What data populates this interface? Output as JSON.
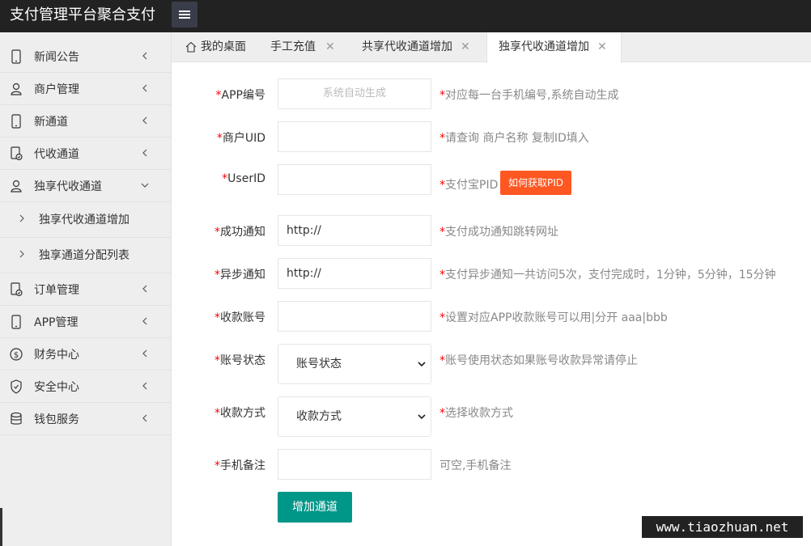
{
  "app": {
    "title": "支付管理平台聚合支付"
  },
  "sidebar": {
    "items": [
      {
        "label": "新闻公告",
        "icon": "phone-icon"
      },
      {
        "label": "商户管理",
        "icon": "user-icon"
      },
      {
        "label": "新通道",
        "icon": "phone-icon"
      },
      {
        "label": "代收通道",
        "icon": "document-check-icon"
      },
      {
        "label": "独享代收通道",
        "icon": "user-icon",
        "expanded": true,
        "children": [
          {
            "label": "独享代收通道增加"
          },
          {
            "label": "独享通道分配列表"
          }
        ]
      },
      {
        "label": "订单管理",
        "icon": "document-check-icon"
      },
      {
        "label": "APP管理",
        "icon": "phone-icon"
      },
      {
        "label": "财务中心",
        "icon": "dollar-circle-icon"
      },
      {
        "label": "安全中心",
        "icon": "shield-icon"
      },
      {
        "label": "钱包服务",
        "icon": "database-icon"
      }
    ]
  },
  "tabs": [
    {
      "label": "我的桌面",
      "icon": "home-icon",
      "closable": false
    },
    {
      "label": "手工充值",
      "closable": true
    },
    {
      "label": "共享代收通道增加",
      "closable": true
    },
    {
      "label": "独享代收通道增加",
      "closable": true,
      "active": true
    }
  ],
  "form": {
    "required_mark": "*",
    "fields": [
      {
        "label": "APP编号",
        "value": "",
        "placeholder": "系统自动生成",
        "hint": "对应每一台手机编号,系统自动生成",
        "required": true
      },
      {
        "label": "商户UID",
        "value": "",
        "hint": "请查询 商户名称 复制ID填入",
        "required": true
      },
      {
        "label": "UserID",
        "value": "",
        "hint": "支付宝PID",
        "required": true,
        "button": "如何获取PID"
      },
      {
        "label": "成功通知",
        "value": "http://",
        "hint": "支付成功通知跳转网址",
        "required": true
      },
      {
        "label": "异步通知",
        "value": "http://",
        "hint": "支付异步通知一共访问5次，支付完成时，1分钟，5分钟，15分钟",
        "required": true
      },
      {
        "label": "收款账号",
        "value": "",
        "hint": "设置对应APP收款账号可以用|分开 aaa|bbb",
        "required": true
      },
      {
        "label": "账号状态",
        "select": "账号状态",
        "hint": "账号使用状态如果账号收款异常请停止",
        "required": true
      },
      {
        "label": "收款方式",
        "select": "收款方式",
        "hint": "选择收款方式",
        "required": true
      },
      {
        "label": "手机备注",
        "value": "",
        "hint": "可空,手机备注",
        "required": true,
        "hint_required": false
      }
    ],
    "submit_label": "增加通道"
  },
  "colors": {
    "topbar": "#222222",
    "submit": "#009688",
    "pid_button": "#FF5722",
    "required": "#FF0000"
  },
  "watermark": "www.tiaozhuan.net"
}
